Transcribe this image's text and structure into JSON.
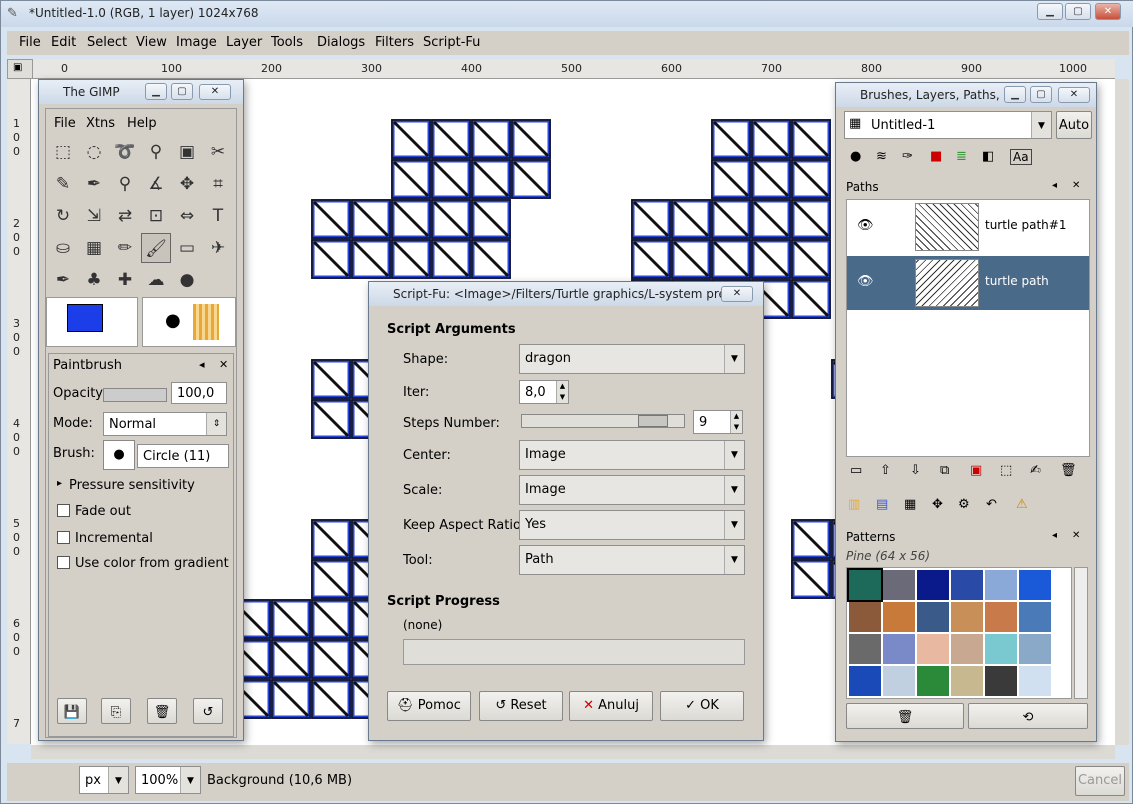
{
  "window": {
    "title": "*Untitled-1.0 (RGB, 1 layer) 1024x768"
  },
  "menubar": [
    "File",
    "Edit",
    "Select",
    "View",
    "Image",
    "Layer",
    "Tools",
    "Dialogs",
    "Filters",
    "Script-Fu"
  ],
  "hruler_ticks": [
    "0",
    "100",
    "200",
    "300",
    "400",
    "500",
    "600",
    "700",
    "800",
    "900",
    "1000"
  ],
  "vruler_ticks": [
    "1",
    "0",
    "0",
    "2",
    "0",
    "0",
    "3",
    "0",
    "0",
    "4",
    "0",
    "0",
    "5",
    "0",
    "0",
    "6",
    "0",
    "0",
    "7"
  ],
  "statusbar": {
    "unit": "px",
    "zoom": "100%",
    "message": "Background (10,6 MB)",
    "cancel": "Cancel"
  },
  "toolbox": {
    "title": "The GIMP",
    "menu": [
      "File",
      "Xtns",
      "Help"
    ],
    "tool_icons": [
      "rect-select-icon",
      "ellipse-select-icon",
      "free-select-icon",
      "fuzzy-select-icon",
      "color-select-icon",
      "scissors-icon",
      "paths-icon",
      "color-picker-icon",
      "zoom-icon",
      "measure-icon",
      "move-icon",
      "crop-icon",
      "rotate-icon",
      "scale-icon",
      "shear-icon",
      "perspective-icon",
      "flip-icon",
      "text-icon",
      "bucket-fill-icon",
      "blend-icon",
      "pencil-icon",
      "paintbrush-icon",
      "eraser-icon",
      "airbrush-icon",
      "ink-icon",
      "clone-icon",
      "heal-icon",
      "smudge-icon",
      "dodge-icon"
    ],
    "tool_glyphs": [
      "⬚",
      "◌",
      "➰",
      "⚲",
      "▣",
      "✂",
      "✎",
      "✒",
      "⚲",
      "∡",
      "✥",
      "⌗",
      "↻",
      "⇲",
      "⇄",
      "⊡",
      "⇔",
      "T",
      "⛀",
      "▦",
      "✏",
      "🖌",
      "▭",
      "✈",
      "✒",
      "♣",
      "✚",
      "☁",
      "●"
    ],
    "fg_color": "#1b3ee8",
    "bg_color": "#ffffff",
    "options_title": "Paintbrush",
    "opacity_label": "Opacity:",
    "opacity_value": "100,0",
    "mode_label": "Mode:",
    "mode_value": "Normal",
    "brush_label": "Brush:",
    "brush_value": "Circle (11)",
    "pressure_label": "Pressure sensitivity",
    "fade_label": "Fade out",
    "incremental_label": "Incremental",
    "gradient_label": "Use color from gradient"
  },
  "scriptfu": {
    "title": "Script-Fu: <Image>/Filters/Turtle graphics/L-system preset",
    "args_header": "Script Arguments",
    "shape_label": "Shape:",
    "shape_value": "dragon",
    "iter_label": "Iter:",
    "iter_value": "8,0",
    "steps_label": "Steps Number:",
    "steps_value": "9",
    "center_label": "Center:",
    "center_value": "Image",
    "scale_label": "Scale:",
    "scale_value": "Image",
    "aspect_label": "Keep Aspect Ratio:",
    "aspect_value": "Yes",
    "tool_label": "Tool:",
    "tool_value": "Path",
    "progress_header": "Script Progress",
    "progress_text": "(none)",
    "btn_help": "Pomoc",
    "btn_reset": "Reset",
    "btn_cancel": "Anuluj",
    "btn_ok": "OK"
  },
  "dock": {
    "title": "Brushes, Layers, Paths, ...",
    "image_combo": "Untitled-1",
    "auto_label": "Auto",
    "paths_title": "Paths",
    "paths": [
      {
        "name": "turtle path#1"
      },
      {
        "name": "turtle path"
      }
    ],
    "patterns_title": "Patterns",
    "pattern_selected": "Pine (64 x 56)",
    "pattern_colors": [
      "#1e6a5a",
      "#6a6a78",
      "#0a1a8a",
      "#2a4aa8",
      "#8aa8d8",
      "#1a5ad8",
      "#8a5a3a",
      "#c87a3a",
      "#3a5a8a",
      "#c89058",
      "#c87a4a",
      "#4a7ab8",
      "#6a6a6a",
      "#7a8ac8",
      "#e8b8a0",
      "#c8a890",
      "#7ac8d0",
      "#8aa8c8",
      "#1a4ab8",
      "#c0d0e0",
      "#2a8a3a",
      "#c8b890",
      "#3a3a3a",
      "#d0e0f0"
    ]
  }
}
